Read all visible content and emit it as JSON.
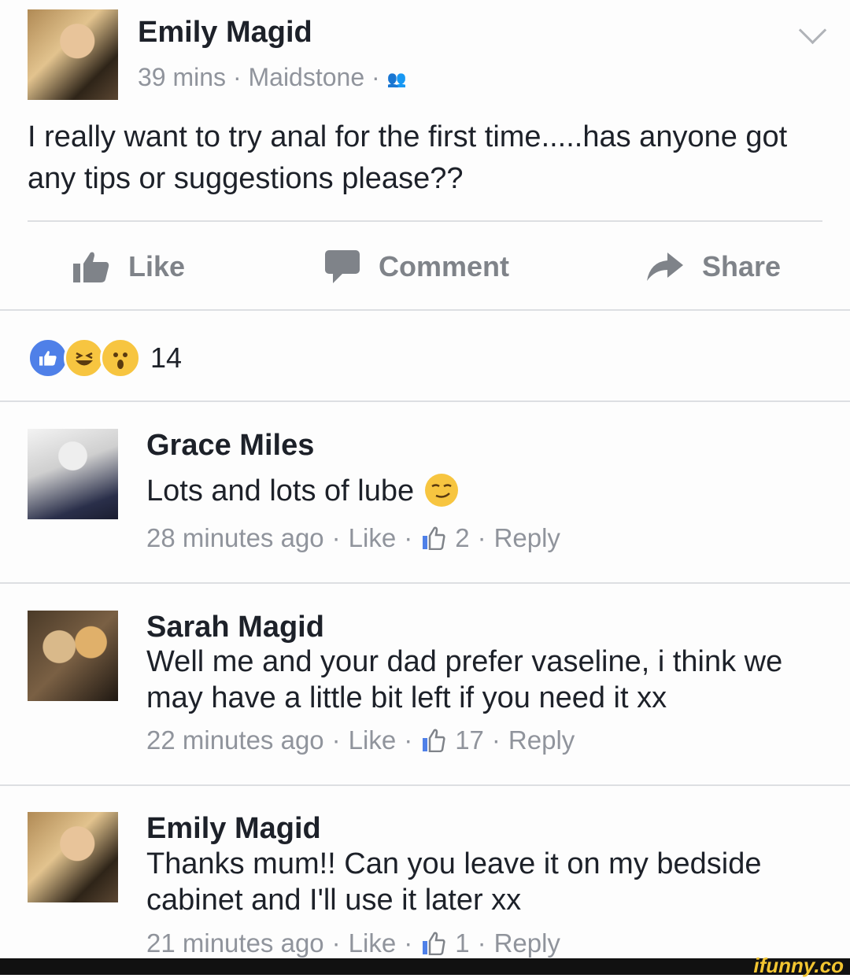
{
  "post": {
    "author": "Emily Magid",
    "time": "39 mins",
    "location": "Maidstone",
    "body": "I really want to try anal for the first time.....has anyone got any tips or suggestions please??"
  },
  "actions": {
    "like": "Like",
    "comment": "Comment",
    "share": "Share"
  },
  "reactions": {
    "count": "14",
    "types": [
      "like-icon",
      "haha-icon",
      "wow-icon"
    ]
  },
  "comments": [
    {
      "author": "Grace Miles",
      "text": "Lots and lots of lube",
      "time": "28 minutes ago",
      "like": "Like",
      "likes": "2",
      "reply": "Reply"
    },
    {
      "author": "Sarah Magid",
      "text": "Well me and your dad prefer vaseline, i think we may have a little bit left if you need it xx",
      "time": "22 minutes ago",
      "like": "Like",
      "likes": "17",
      "reply": "Reply"
    },
    {
      "author": "Emily Magid",
      "text": "Thanks mum!! Can you leave it on my bedside cabinet and I'll use it later xx",
      "time": "21 minutes ago",
      "like": "Like",
      "likes": "1",
      "reply": "Reply"
    }
  ],
  "watermark": "ifunny.co",
  "colors": {
    "text": "#1d2129",
    "meta": "#90949c",
    "action": "#7f8389",
    "like_blue": "#4f80e8"
  }
}
